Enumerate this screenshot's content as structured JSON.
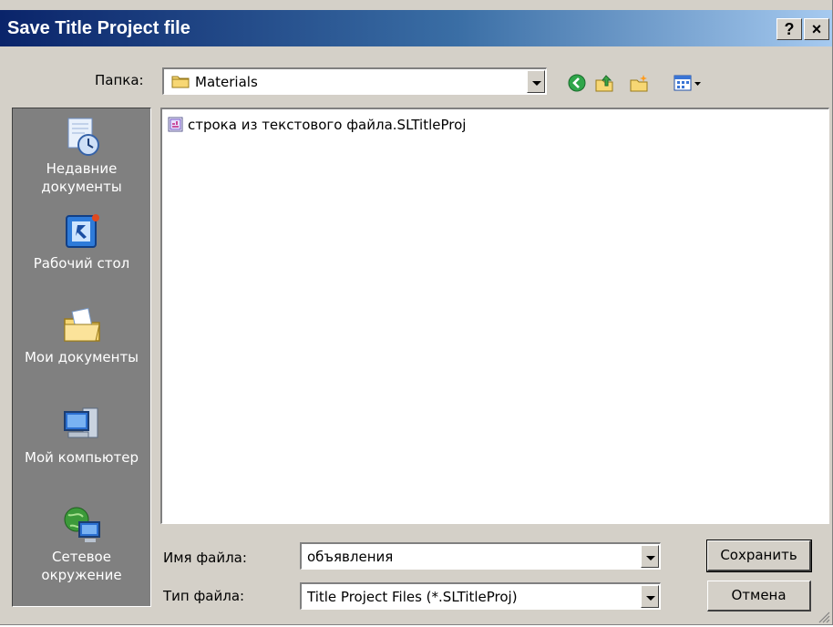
{
  "window": {
    "title": "Save Title Project file",
    "help_button": "?",
    "close_button": "×"
  },
  "lookin": {
    "label": "Папка:",
    "value": "Materials"
  },
  "toolbar": {
    "icons": [
      "back-icon",
      "up-folder-icon",
      "new-folder-icon",
      "views-menu-icon"
    ]
  },
  "places": [
    {
      "label": "Недавние документы",
      "icon": "recent-documents-icon"
    },
    {
      "label": "Рабочий стол",
      "icon": "desktop-icon"
    },
    {
      "label": "Мои документы",
      "icon": "my-documents-icon"
    },
    {
      "label": "Мой компьютер",
      "icon": "my-computer-icon"
    },
    {
      "label": "Сетевое окружение",
      "icon": "network-places-icon"
    }
  ],
  "files": [
    {
      "name": "строка из текстового файла.SLTitleProj",
      "icon": "sltitleproj-file-icon"
    }
  ],
  "filename": {
    "label": "Имя файла:",
    "value": "объявления"
  },
  "filetype": {
    "label": "Тип файла:",
    "value": "Title Project Files (*.SLTitleProj)"
  },
  "buttons": {
    "save": "Сохранить",
    "cancel": "Отмена"
  }
}
